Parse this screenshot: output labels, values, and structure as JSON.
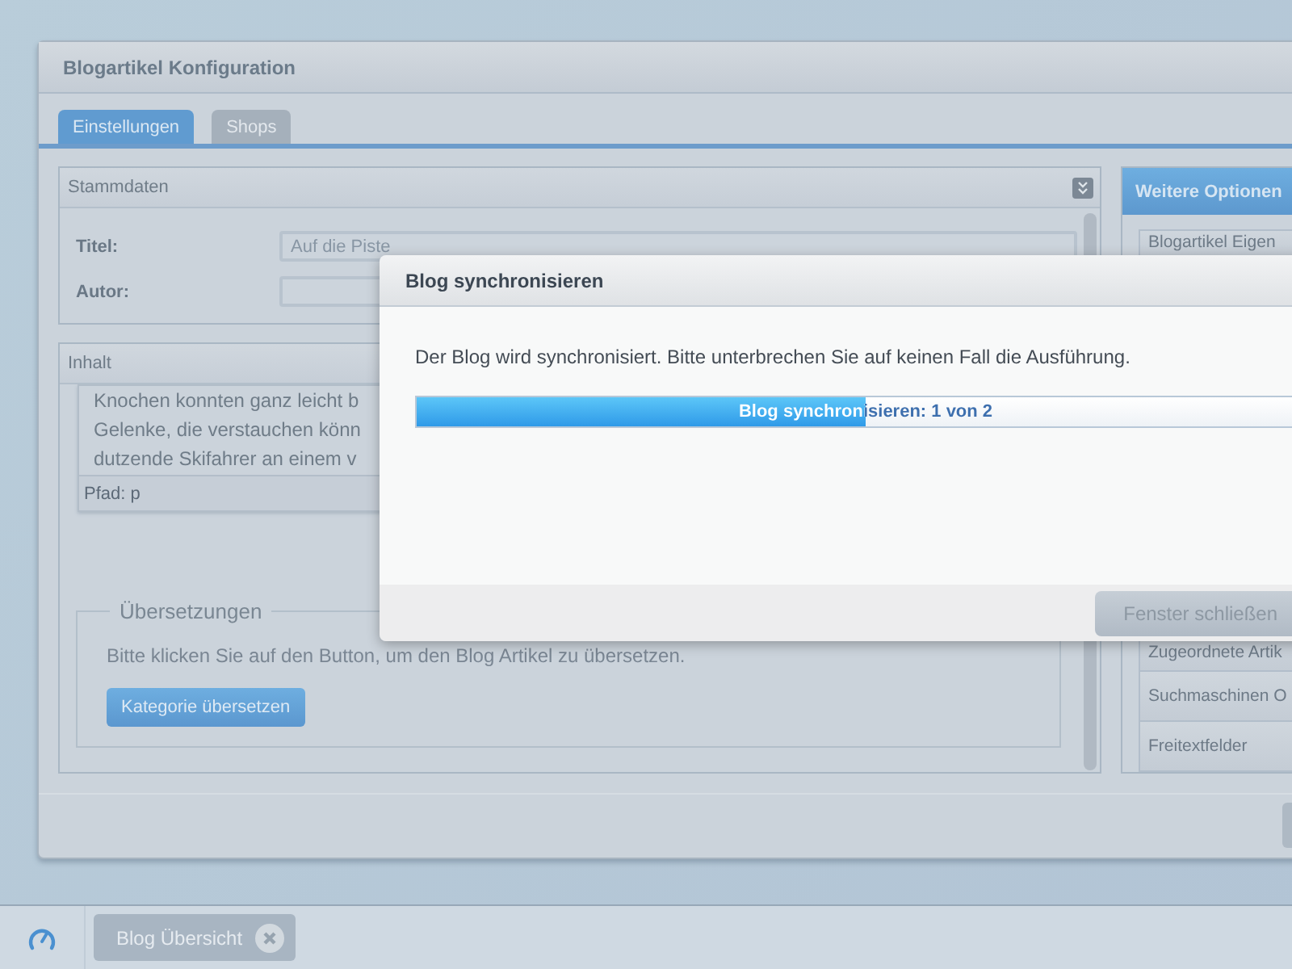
{
  "window": {
    "title": "Blogartikel Konfiguration"
  },
  "tabs": [
    {
      "label": "Einstellungen",
      "selected": true
    },
    {
      "label": "Shops",
      "selected": false
    }
  ],
  "stammdaten": {
    "title": "Stammdaten",
    "fields": [
      {
        "label": "Titel:",
        "value": "Auf die Piste"
      },
      {
        "label": "Autor:"
      }
    ]
  },
  "inhalt": {
    "title": "Inhalt",
    "lines": [
      "Knochen konnten ganz leicht b",
      "Gelenke, die verstauchen könn",
      "dutzende Skifahrer an einem v"
    ],
    "path": "Pfad: p"
  },
  "translations": {
    "legend": "Übersetzungen",
    "text": "Bitte klicken Sie auf den Button, um den Blog Artikel zu übersetzen.",
    "button": "Kategorie übersetzen"
  },
  "options": {
    "title": "Weitere Optionen",
    "items": [
      "Blogartikel Eigen",
      "Zugeordnete Artik",
      "Suchmaschinen O",
      "Freitextfelder"
    ]
  },
  "dialog": {
    "title": "Blog synchronisieren",
    "message": "Der Blog wird synchronisiert. Bitte unterbrechen Sie auf keinen Fall die Ausführung.",
    "progress": {
      "level": 0.5,
      "label": "Blog synchronisieren: 1 von 2"
    },
    "button": "Fenster schließen"
  },
  "taskbar": {
    "items": [
      {
        "label": "Blog Übersicht"
      }
    ]
  }
}
